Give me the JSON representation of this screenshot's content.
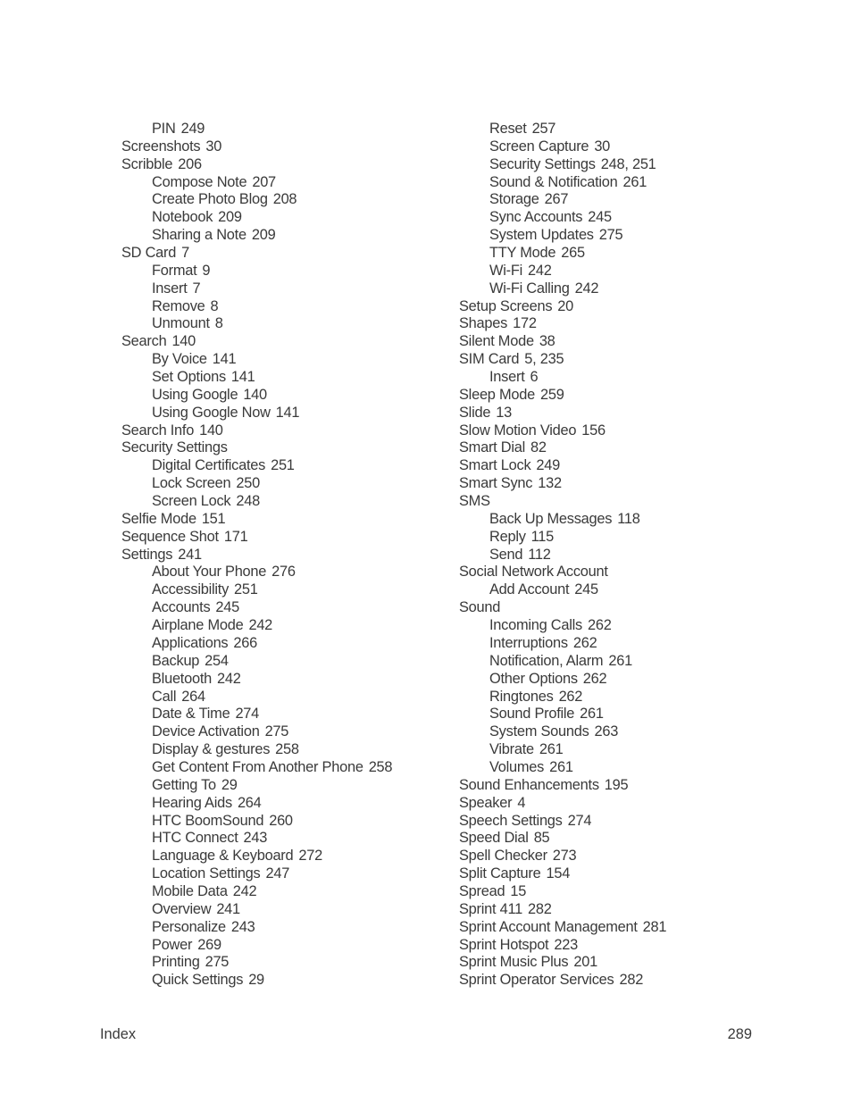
{
  "footer": {
    "section": "Index",
    "page_number": "289"
  },
  "columns": [
    {
      "entries": [
        {
          "level": 1,
          "term": "PIN",
          "pages": "249"
        },
        {
          "level": 0,
          "term": "Screenshots",
          "pages": "30"
        },
        {
          "level": 0,
          "term": "Scribble",
          "pages": "206"
        },
        {
          "level": 1,
          "term": "Compose Note",
          "pages": "207"
        },
        {
          "level": 1,
          "term": "Create Photo Blog",
          "pages": "208"
        },
        {
          "level": 1,
          "term": "Notebook",
          "pages": "209"
        },
        {
          "level": 1,
          "term": "Sharing a Note",
          "pages": "209"
        },
        {
          "level": 0,
          "term": "SD Card",
          "pages": "7"
        },
        {
          "level": 1,
          "term": "Format",
          "pages": "9"
        },
        {
          "level": 1,
          "term": "Insert",
          "pages": "7"
        },
        {
          "level": 1,
          "term": "Remove",
          "pages": "8"
        },
        {
          "level": 1,
          "term": "Unmount",
          "pages": "8"
        },
        {
          "level": 0,
          "term": "Search",
          "pages": "140"
        },
        {
          "level": 1,
          "term": "By Voice",
          "pages": "141"
        },
        {
          "level": 1,
          "term": "Set Options",
          "pages": "141"
        },
        {
          "level": 1,
          "term": "Using Google",
          "pages": "140"
        },
        {
          "level": 1,
          "term": "Using Google Now",
          "pages": "141"
        },
        {
          "level": 0,
          "term": "Search Info",
          "pages": "140"
        },
        {
          "level": 0,
          "term": "Security Settings",
          "pages": ""
        },
        {
          "level": 1,
          "term": "Digital Certificates",
          "pages": "251"
        },
        {
          "level": 1,
          "term": "Lock Screen",
          "pages": "250"
        },
        {
          "level": 1,
          "term": "Screen Lock",
          "pages": "248"
        },
        {
          "level": 0,
          "term": "Selfie Mode",
          "pages": "151"
        },
        {
          "level": 0,
          "term": "Sequence Shot",
          "pages": "171"
        },
        {
          "level": 0,
          "term": "Settings",
          "pages": "241"
        },
        {
          "level": 1,
          "term": "About Your Phone",
          "pages": "276"
        },
        {
          "level": 1,
          "term": "Accessibility",
          "pages": "251"
        },
        {
          "level": 1,
          "term": "Accounts",
          "pages": "245"
        },
        {
          "level": 1,
          "term": "Airplane Mode",
          "pages": "242"
        },
        {
          "level": 1,
          "term": "Applications",
          "pages": "266"
        },
        {
          "level": 1,
          "term": "Backup",
          "pages": "254"
        },
        {
          "level": 1,
          "term": "Bluetooth",
          "pages": "242"
        },
        {
          "level": 1,
          "term": "Call",
          "pages": "264"
        },
        {
          "level": 1,
          "term": "Date & Time",
          "pages": "274"
        },
        {
          "level": 1,
          "term": "Device Activation",
          "pages": "275"
        },
        {
          "level": 1,
          "term": "Display & gestures",
          "pages": "258"
        },
        {
          "level": 1,
          "term": "Get Content From Another Phone",
          "pages": "258"
        },
        {
          "level": 1,
          "term": "Getting To",
          "pages": "29"
        },
        {
          "level": 1,
          "term": "Hearing Aids",
          "pages": "264"
        },
        {
          "level": 1,
          "term": "HTC BoomSound",
          "pages": "260"
        },
        {
          "level": 1,
          "term": "HTC Connect",
          "pages": "243"
        },
        {
          "level": 1,
          "term": "Language & Keyboard",
          "pages": "272"
        },
        {
          "level": 1,
          "term": "Location Settings",
          "pages": "247"
        },
        {
          "level": 1,
          "term": "Mobile Data",
          "pages": "242"
        },
        {
          "level": 1,
          "term": "Overview",
          "pages": "241"
        },
        {
          "level": 1,
          "term": "Personalize",
          "pages": "243"
        },
        {
          "level": 1,
          "term": "Power",
          "pages": "269"
        },
        {
          "level": 1,
          "term": "Printing",
          "pages": "275"
        },
        {
          "level": 1,
          "term": "Quick Settings",
          "pages": "29"
        }
      ]
    },
    {
      "entries": [
        {
          "level": 1,
          "term": "Reset",
          "pages": "257"
        },
        {
          "level": 1,
          "term": "Screen Capture",
          "pages": "30"
        },
        {
          "level": 1,
          "term": "Security Settings",
          "pages": "248, 251"
        },
        {
          "level": 1,
          "term": "Sound & Notification",
          "pages": "261"
        },
        {
          "level": 1,
          "term": "Storage",
          "pages": "267"
        },
        {
          "level": 1,
          "term": "Sync Accounts",
          "pages": "245"
        },
        {
          "level": 1,
          "term": "System Updates",
          "pages": "275"
        },
        {
          "level": 1,
          "term": "TTY Mode",
          "pages": "265"
        },
        {
          "level": 1,
          "term": "Wi-Fi",
          "pages": "242"
        },
        {
          "level": 1,
          "term": "Wi-Fi Calling",
          "pages": "242"
        },
        {
          "level": 0,
          "term": "Setup Screens",
          "pages": "20"
        },
        {
          "level": 0,
          "term": "Shapes",
          "pages": "172"
        },
        {
          "level": 0,
          "term": "Silent Mode",
          "pages": "38"
        },
        {
          "level": 0,
          "term": "SIM Card",
          "pages": "5, 235"
        },
        {
          "level": 1,
          "term": "Insert",
          "pages": "6"
        },
        {
          "level": 0,
          "term": "Sleep Mode",
          "pages": "259"
        },
        {
          "level": 0,
          "term": "Slide",
          "pages": "13"
        },
        {
          "level": 0,
          "term": "Slow Motion Video",
          "pages": "156"
        },
        {
          "level": 0,
          "term": "Smart Dial",
          "pages": "82"
        },
        {
          "level": 0,
          "term": "Smart Lock",
          "pages": "249"
        },
        {
          "level": 0,
          "term": "Smart Sync",
          "pages": "132"
        },
        {
          "level": 0,
          "term": "SMS",
          "pages": ""
        },
        {
          "level": 1,
          "term": "Back Up Messages",
          "pages": "118"
        },
        {
          "level": 1,
          "term": "Reply",
          "pages": "115"
        },
        {
          "level": 1,
          "term": "Send",
          "pages": "112"
        },
        {
          "level": 0,
          "term": "Social Network Account",
          "pages": ""
        },
        {
          "level": 1,
          "term": "Add Account",
          "pages": "245"
        },
        {
          "level": 0,
          "term": "Sound",
          "pages": ""
        },
        {
          "level": 1,
          "term": "Incoming Calls",
          "pages": "262"
        },
        {
          "level": 1,
          "term": "Interruptions",
          "pages": "262"
        },
        {
          "level": 1,
          "term": "Notification, Alarm",
          "pages": "261"
        },
        {
          "level": 1,
          "term": "Other Options",
          "pages": "262"
        },
        {
          "level": 1,
          "term": "Ringtones",
          "pages": "262"
        },
        {
          "level": 1,
          "term": "Sound Profile",
          "pages": "261"
        },
        {
          "level": 1,
          "term": "System Sounds",
          "pages": "263"
        },
        {
          "level": 1,
          "term": "Vibrate",
          "pages": "261"
        },
        {
          "level": 1,
          "term": "Volumes",
          "pages": "261"
        },
        {
          "level": 0,
          "term": "Sound Enhancements",
          "pages": "195"
        },
        {
          "level": 0,
          "term": "Speaker",
          "pages": "4"
        },
        {
          "level": 0,
          "term": "Speech Settings",
          "pages": "274"
        },
        {
          "level": 0,
          "term": "Speed Dial",
          "pages": "85"
        },
        {
          "level": 0,
          "term": "Spell Checker",
          "pages": "273"
        },
        {
          "level": 0,
          "term": "Split Capture",
          "pages": "154"
        },
        {
          "level": 0,
          "term": "Spread",
          "pages": "15"
        },
        {
          "level": 0,
          "term": "Sprint 411",
          "pages": "282"
        },
        {
          "level": 0,
          "term": "Sprint Account Management",
          "pages": "281"
        },
        {
          "level": 0,
          "term": "Sprint Hotspot",
          "pages": "223"
        },
        {
          "level": 0,
          "term": "Sprint Music Plus",
          "pages": "201"
        },
        {
          "level": 0,
          "term": "Sprint Operator Services",
          "pages": "282"
        }
      ]
    }
  ]
}
